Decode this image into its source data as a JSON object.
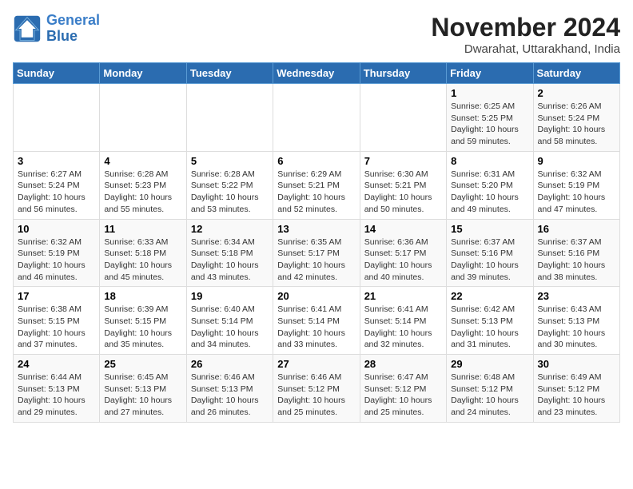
{
  "header": {
    "logo_line1": "General",
    "logo_line2": "Blue",
    "title": "November 2024",
    "subtitle": "Dwarahat, Uttarakhand, India"
  },
  "weekdays": [
    "Sunday",
    "Monday",
    "Tuesday",
    "Wednesday",
    "Thursday",
    "Friday",
    "Saturday"
  ],
  "weeks": [
    [
      {
        "day": "",
        "info": ""
      },
      {
        "day": "",
        "info": ""
      },
      {
        "day": "",
        "info": ""
      },
      {
        "day": "",
        "info": ""
      },
      {
        "day": "",
        "info": ""
      },
      {
        "day": "1",
        "info": "Sunrise: 6:25 AM\nSunset: 5:25 PM\nDaylight: 10 hours\nand 59 minutes."
      },
      {
        "day": "2",
        "info": "Sunrise: 6:26 AM\nSunset: 5:24 PM\nDaylight: 10 hours\nand 58 minutes."
      }
    ],
    [
      {
        "day": "3",
        "info": "Sunrise: 6:27 AM\nSunset: 5:24 PM\nDaylight: 10 hours\nand 56 minutes."
      },
      {
        "day": "4",
        "info": "Sunrise: 6:28 AM\nSunset: 5:23 PM\nDaylight: 10 hours\nand 55 minutes."
      },
      {
        "day": "5",
        "info": "Sunrise: 6:28 AM\nSunset: 5:22 PM\nDaylight: 10 hours\nand 53 minutes."
      },
      {
        "day": "6",
        "info": "Sunrise: 6:29 AM\nSunset: 5:21 PM\nDaylight: 10 hours\nand 52 minutes."
      },
      {
        "day": "7",
        "info": "Sunrise: 6:30 AM\nSunset: 5:21 PM\nDaylight: 10 hours\nand 50 minutes."
      },
      {
        "day": "8",
        "info": "Sunrise: 6:31 AM\nSunset: 5:20 PM\nDaylight: 10 hours\nand 49 minutes."
      },
      {
        "day": "9",
        "info": "Sunrise: 6:32 AM\nSunset: 5:19 PM\nDaylight: 10 hours\nand 47 minutes."
      }
    ],
    [
      {
        "day": "10",
        "info": "Sunrise: 6:32 AM\nSunset: 5:19 PM\nDaylight: 10 hours\nand 46 minutes."
      },
      {
        "day": "11",
        "info": "Sunrise: 6:33 AM\nSunset: 5:18 PM\nDaylight: 10 hours\nand 45 minutes."
      },
      {
        "day": "12",
        "info": "Sunrise: 6:34 AM\nSunset: 5:18 PM\nDaylight: 10 hours\nand 43 minutes."
      },
      {
        "day": "13",
        "info": "Sunrise: 6:35 AM\nSunset: 5:17 PM\nDaylight: 10 hours\nand 42 minutes."
      },
      {
        "day": "14",
        "info": "Sunrise: 6:36 AM\nSunset: 5:17 PM\nDaylight: 10 hours\nand 40 minutes."
      },
      {
        "day": "15",
        "info": "Sunrise: 6:37 AM\nSunset: 5:16 PM\nDaylight: 10 hours\nand 39 minutes."
      },
      {
        "day": "16",
        "info": "Sunrise: 6:37 AM\nSunset: 5:16 PM\nDaylight: 10 hours\nand 38 minutes."
      }
    ],
    [
      {
        "day": "17",
        "info": "Sunrise: 6:38 AM\nSunset: 5:15 PM\nDaylight: 10 hours\nand 37 minutes."
      },
      {
        "day": "18",
        "info": "Sunrise: 6:39 AM\nSunset: 5:15 PM\nDaylight: 10 hours\nand 35 minutes."
      },
      {
        "day": "19",
        "info": "Sunrise: 6:40 AM\nSunset: 5:14 PM\nDaylight: 10 hours\nand 34 minutes."
      },
      {
        "day": "20",
        "info": "Sunrise: 6:41 AM\nSunset: 5:14 PM\nDaylight: 10 hours\nand 33 minutes."
      },
      {
        "day": "21",
        "info": "Sunrise: 6:41 AM\nSunset: 5:14 PM\nDaylight: 10 hours\nand 32 minutes."
      },
      {
        "day": "22",
        "info": "Sunrise: 6:42 AM\nSunset: 5:13 PM\nDaylight: 10 hours\nand 31 minutes."
      },
      {
        "day": "23",
        "info": "Sunrise: 6:43 AM\nSunset: 5:13 PM\nDaylight: 10 hours\nand 30 minutes."
      }
    ],
    [
      {
        "day": "24",
        "info": "Sunrise: 6:44 AM\nSunset: 5:13 PM\nDaylight: 10 hours\nand 29 minutes."
      },
      {
        "day": "25",
        "info": "Sunrise: 6:45 AM\nSunset: 5:13 PM\nDaylight: 10 hours\nand 27 minutes."
      },
      {
        "day": "26",
        "info": "Sunrise: 6:46 AM\nSunset: 5:13 PM\nDaylight: 10 hours\nand 26 minutes."
      },
      {
        "day": "27",
        "info": "Sunrise: 6:46 AM\nSunset: 5:12 PM\nDaylight: 10 hours\nand 25 minutes."
      },
      {
        "day": "28",
        "info": "Sunrise: 6:47 AM\nSunset: 5:12 PM\nDaylight: 10 hours\nand 25 minutes."
      },
      {
        "day": "29",
        "info": "Sunrise: 6:48 AM\nSunset: 5:12 PM\nDaylight: 10 hours\nand 24 minutes."
      },
      {
        "day": "30",
        "info": "Sunrise: 6:49 AM\nSunset: 5:12 PM\nDaylight: 10 hours\nand 23 minutes."
      }
    ]
  ]
}
